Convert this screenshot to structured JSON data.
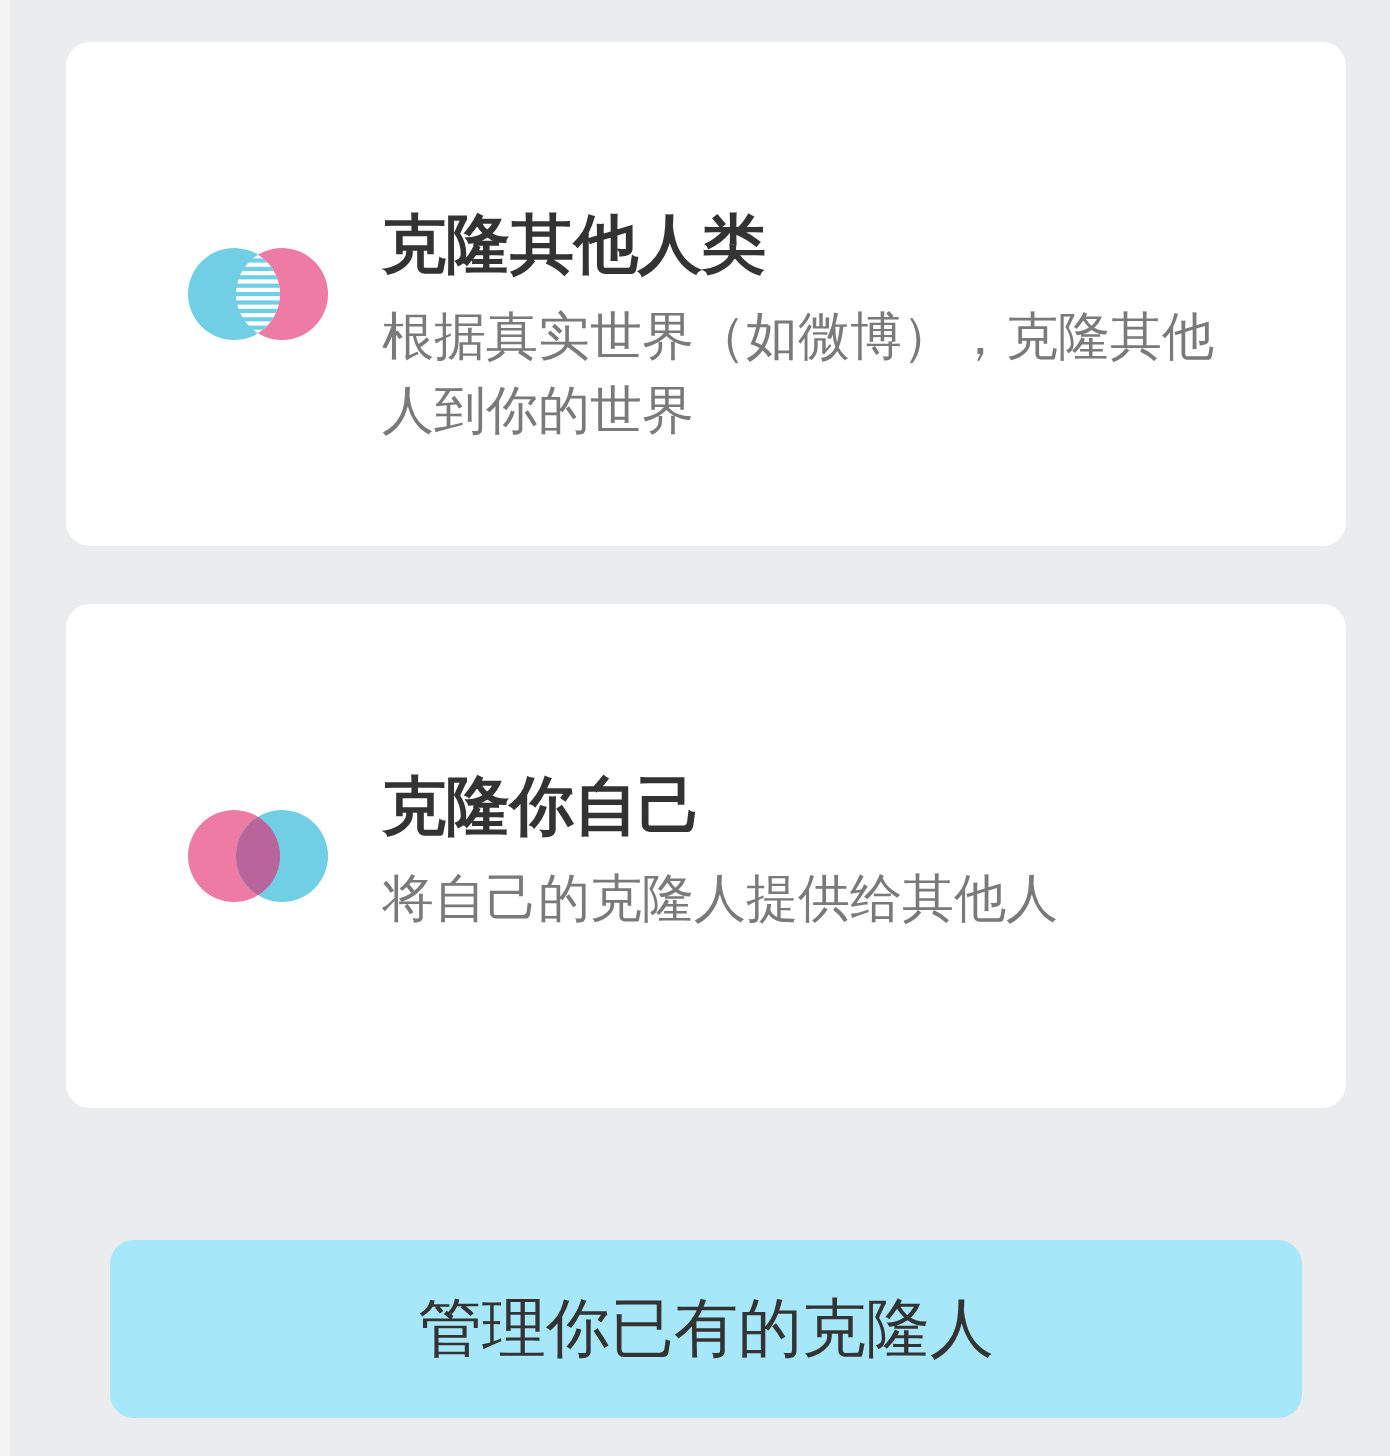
{
  "cards": [
    {
      "kind": "striped-overlap",
      "title": "克隆其他人类",
      "description": "根据真实世界（如微博），克隆其他人到你的世界"
    },
    {
      "kind": "solid-overlap",
      "title": "克隆你自己",
      "description": "将自己的克隆人提供给其他人"
    }
  ],
  "button": {
    "label": "管理你已有的克隆人"
  }
}
